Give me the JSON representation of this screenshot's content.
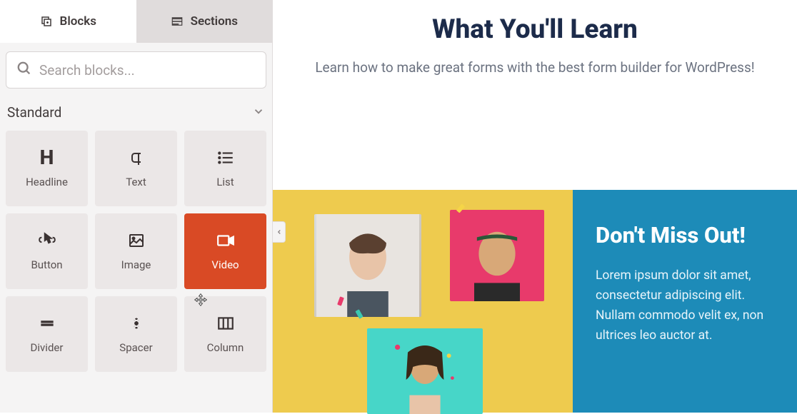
{
  "tabs": {
    "blocks": "Blocks",
    "sections": "Sections"
  },
  "search": {
    "placeholder": "Search blocks..."
  },
  "category": {
    "title": "Standard"
  },
  "blocks": [
    {
      "label": "Headline"
    },
    {
      "label": "Text"
    },
    {
      "label": "List"
    },
    {
      "label": "Button"
    },
    {
      "label": "Image"
    },
    {
      "label": "Video"
    },
    {
      "label": "Divider"
    },
    {
      "label": "Spacer"
    },
    {
      "label": "Column"
    }
  ],
  "hero": {
    "title": "What You'll Learn",
    "subtitle": "Learn how to make great forms with the best form builder for WordPress!"
  },
  "callout": {
    "title": "Don't Miss Out!",
    "body": "Lorem ipsum dolor sit amet, consectetur adipiscing elit. Nullam commodo velit ex, non ultrices leo auctor at."
  }
}
